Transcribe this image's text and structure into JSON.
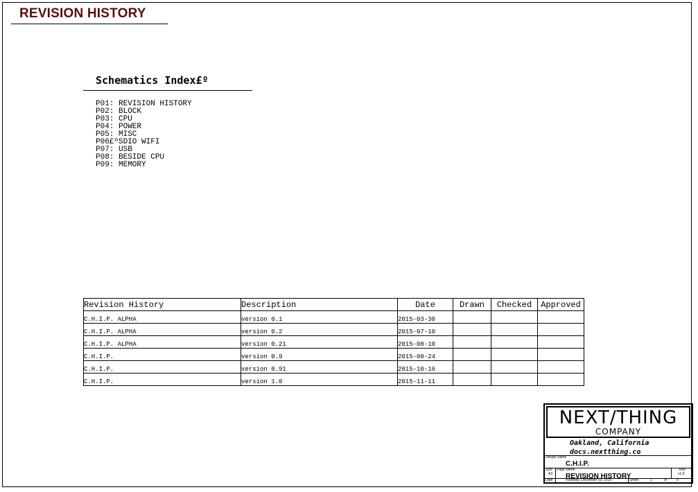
{
  "header": {
    "title": "REVISION HISTORY"
  },
  "index": {
    "title": "Schematics Index£º",
    "items": [
      "P01: REVISION HISTORY",
      "P02: BLOCK",
      "P03: CPU",
      "P04: POWER",
      "P05: MISC",
      "P06£ºSDIO WIFI",
      "P07: USB",
      "P08: BESIDE CPU",
      "P09: MEMORY"
    ]
  },
  "revision_table": {
    "headers": [
      "Revision History",
      "Description",
      "Date",
      "Drawn",
      "Checked",
      "Approved"
    ],
    "rows": [
      {
        "revision": "C.H.I.P. ALPHA",
        "description": "version 0.1",
        "date": "2015-03-30"
      },
      {
        "revision": "C.H.I.P. ALPHA",
        "description": "version 0.2",
        "date": "2015-07-10"
      },
      {
        "revision": "C.H.I.P. ALPHA",
        "description": "version 0.21",
        "date": "2015-08-10"
      },
      {
        "revision": "C.H.I.P.",
        "description": "version 0.9",
        "date": "2015-08-24"
      },
      {
        "revision": "C.H.I.P.",
        "description": "version 0.91",
        "date": "2015-10-16"
      },
      {
        "revision": "C.H.I.P.",
        "description": "version 1.0",
        "date": "2015-11-11"
      }
    ]
  },
  "title_block": {
    "logo_main": "NEXT/THING",
    "logo_sub": "COMPANY",
    "address_line1": "Oakland, California",
    "address_line2": "docs.nextthing.co",
    "design_name_label": "Design Name",
    "design_name": "C.H.I.P.",
    "size_label": "Size",
    "size_value": "A3",
    "page_name_label": "Page Name",
    "page_name": "REVISION HISTORY",
    "rev_label": "Rev",
    "rev_value": "v1.0",
    "date_label": "Date",
    "date_value": "Thursday, December 03, 2015",
    "sheet_label": "Sheet",
    "sheet_value": "1",
    "of_label": "of",
    "of_value": "9"
  }
}
